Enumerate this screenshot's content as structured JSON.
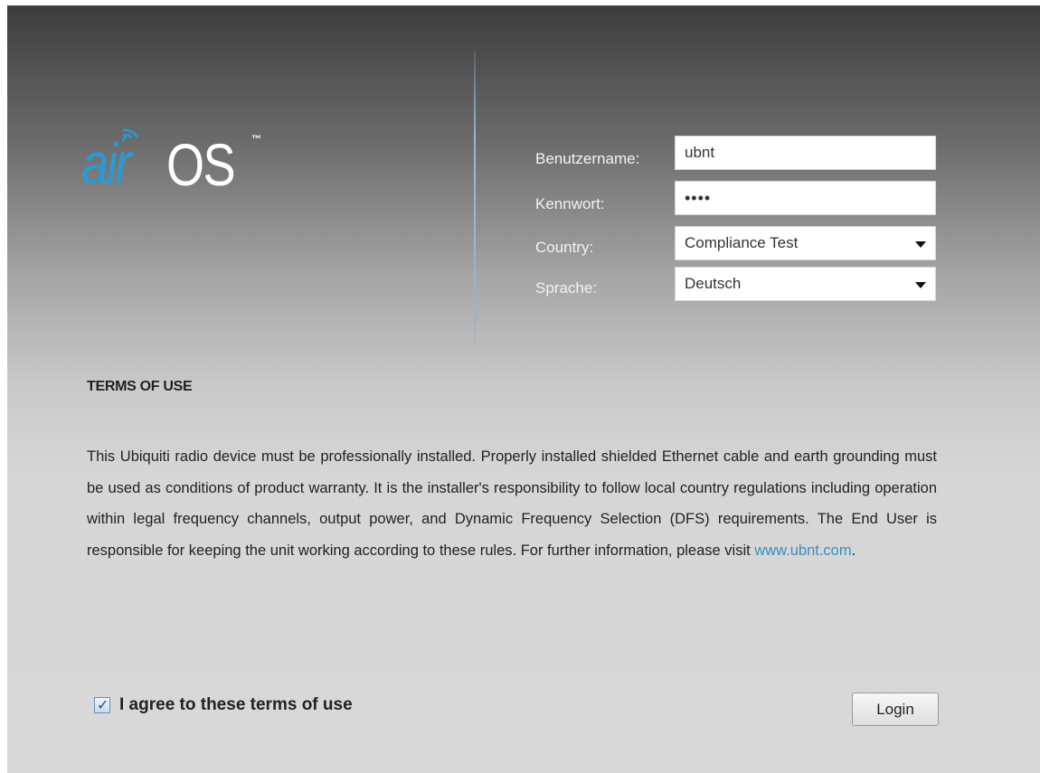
{
  "logo": {
    "air": "air",
    "os": "OS",
    "tm": "™",
    "icon": "wifi-signal-icon"
  },
  "form": {
    "username_label": "Benutzername:",
    "username_value": "ubnt",
    "password_label": "Kennwort:",
    "password_value": "••••",
    "country_label": "Country:",
    "country_value": "Compliance Test",
    "language_label": "Sprache:",
    "language_value": "Deutsch"
  },
  "terms": {
    "title": "TERMS OF USE",
    "body": "This Ubiquiti radio device must be professionally installed. Properly installed shielded Ethernet cable and earth grounding must be used as conditions of product warranty. It is the installer's responsibility to follow local country regulations including operation within legal frequency channels, output power, and Dynamic Frequency Selection (DFS) requirements. The End User is responsible for keeping the unit working according to these rules. For further information, please visit ",
    "link": "www.ubnt.com",
    "end": "."
  },
  "agree": {
    "label": "I agree to these terms of use",
    "checked": true
  },
  "buttons": {
    "login": "Login"
  },
  "colors": {
    "brand_blue": "#2a9ad6",
    "link": "#3a8ec4"
  }
}
